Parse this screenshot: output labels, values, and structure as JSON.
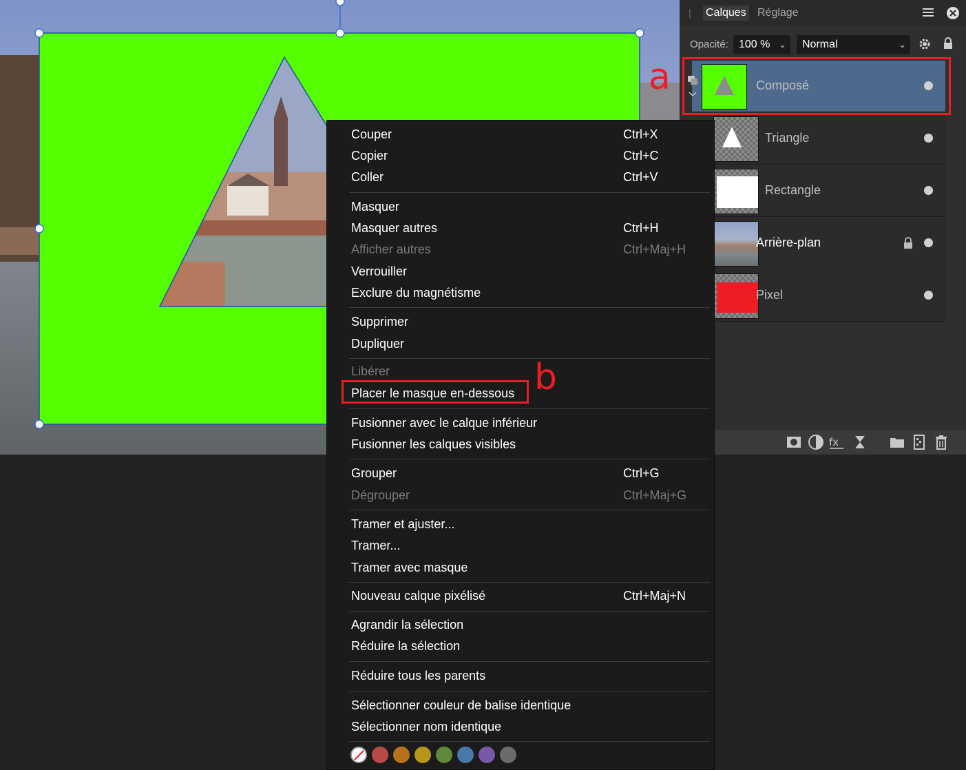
{
  "panel": {
    "tabs": [
      "Calques",
      "Réglage"
    ],
    "opacity_label": "Opacité:",
    "opacity_value": "100 %",
    "blend_mode": "Normal"
  },
  "layers": [
    {
      "name": "Composé",
      "thumb": "green-triangle",
      "selected": true,
      "locked": false
    },
    {
      "name": "Triangle",
      "thumb": "white-triangle",
      "selected": false,
      "locked": false
    },
    {
      "name": "Rectangle",
      "thumb": "white-rectangle",
      "selected": false,
      "locked": false
    },
    {
      "name": "Arrière-plan",
      "thumb": "photo",
      "selected": false,
      "locked": true
    },
    {
      "name": "Pixel",
      "thumb": "red-fill",
      "selected": false,
      "locked": false
    }
  ],
  "menu": {
    "items": [
      {
        "label": "Couper",
        "shortcut": "Ctrl+X"
      },
      {
        "label": "Copier",
        "shortcut": "Ctrl+C"
      },
      {
        "label": "Coller",
        "shortcut": "Ctrl+V"
      },
      {
        "label": "Masquer",
        "shortcut": ""
      },
      {
        "label": "Masquer autres",
        "shortcut": "Ctrl+H"
      },
      {
        "label": "Afficher autres",
        "shortcut": "Ctrl+Maj+H",
        "disabled": true
      },
      {
        "label": "Verrouiller",
        "shortcut": ""
      },
      {
        "label": "Exclure du magnétisme",
        "shortcut": ""
      },
      {
        "label": "Supprimer",
        "shortcut": ""
      },
      {
        "label": "Dupliquer",
        "shortcut": ""
      },
      {
        "label": "Libérer",
        "shortcut": "",
        "disabled": true
      },
      {
        "label": "Placer le masque en-dessous",
        "shortcut": ""
      },
      {
        "label": "Fusionner avec le calque inférieur",
        "shortcut": ""
      },
      {
        "label": "Fusionner les calques visibles",
        "shortcut": ""
      },
      {
        "label": "Grouper",
        "shortcut": "Ctrl+G"
      },
      {
        "label": "Dégrouper",
        "shortcut": "Ctrl+Maj+G",
        "disabled": true
      },
      {
        "label": "Tramer et ajuster...",
        "shortcut": ""
      },
      {
        "label": "Tramer...",
        "shortcut": ""
      },
      {
        "label": "Tramer avec masque",
        "shortcut": ""
      },
      {
        "label": "Nouveau calque pixélisé",
        "shortcut": "Ctrl+Maj+N"
      },
      {
        "label": "Agrandir la sélection",
        "shortcut": ""
      },
      {
        "label": "Réduire la sélection",
        "shortcut": ""
      },
      {
        "label": "Réduire tous les parents",
        "shortcut": ""
      },
      {
        "label": "Sélectionner couleur de balise identique",
        "shortcut": ""
      },
      {
        "label": "Sélectionner nom identique",
        "shortcut": ""
      }
    ],
    "tag_colors": [
      "none",
      "#b94a48",
      "#b8731a",
      "#b8961a",
      "#5f8a3a",
      "#4a78a8",
      "#7a58a8",
      "#6b6b6b"
    ]
  },
  "annotations": {
    "a": "a",
    "b": "b"
  },
  "colors": {
    "shape_fill": "#55ff00",
    "annotation": "#ee1c24",
    "selected_layer": "#4d6a8e"
  }
}
